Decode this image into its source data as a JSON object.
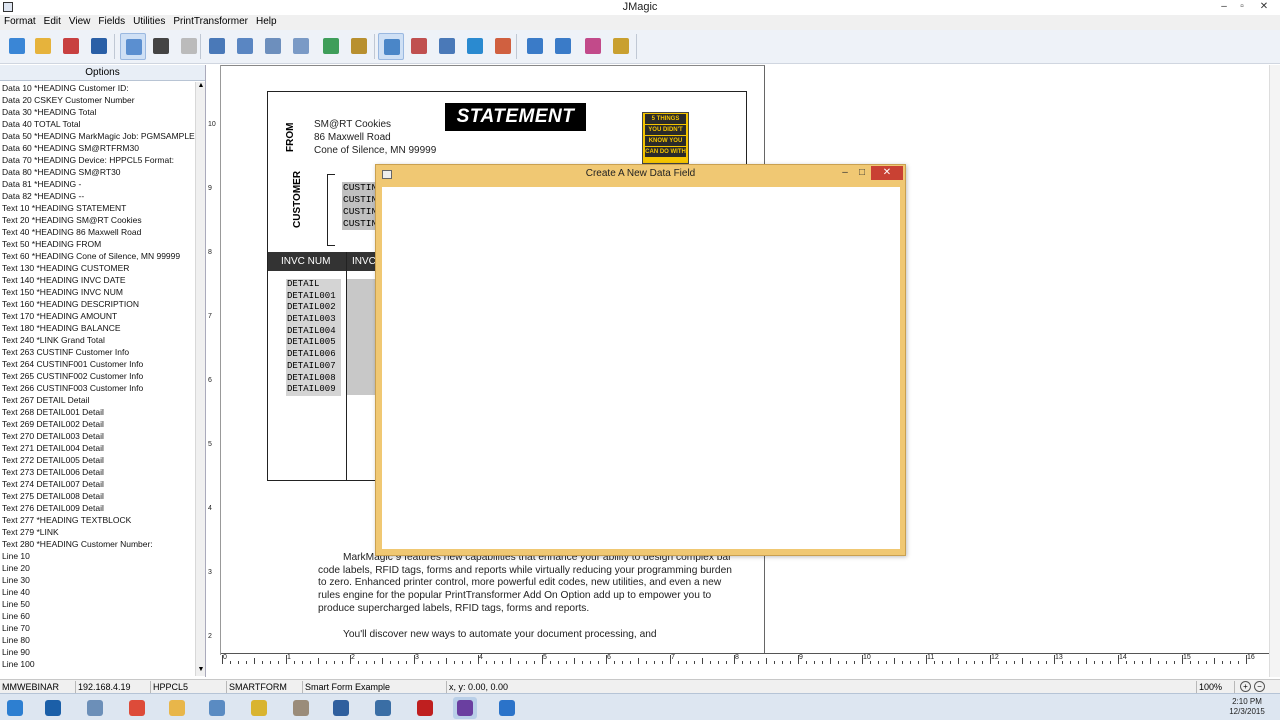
{
  "window": {
    "title": "JMagic",
    "minimize": "–",
    "maximize": "▫",
    "close": "✕"
  },
  "menu": [
    "Format",
    "Edit",
    "View",
    "Fields",
    "Utilities",
    "PrintTransformer",
    "Help"
  ],
  "toolbar": {
    "buttons": [
      {
        "name": "new-form-icon",
        "color": "#3a86d6"
      },
      {
        "name": "open-folder-icon",
        "color": "#e6b33c"
      },
      {
        "name": "save-icon",
        "color": "#c84040"
      },
      {
        "name": "save-as-icon",
        "color": "#2a5fa6"
      },
      {
        "name": "select-pointer-icon",
        "color": "#5b8fd0",
        "active": true
      },
      {
        "name": "barcode-icon",
        "color": "#444"
      },
      {
        "name": "disabled-icon",
        "color": "#bbbbbb"
      },
      {
        "name": "text-field-icon",
        "color": "#4a79b8"
      },
      {
        "name": "data-field-icon",
        "color": "#5a86c2"
      },
      {
        "name": "box-icon",
        "color": "#6d8fbd"
      },
      {
        "name": "line-icon",
        "color": "#7a9ac6"
      },
      {
        "name": "image-icon",
        "color": "#3f9e5a"
      },
      {
        "name": "edit-text-icon",
        "color": "#b89030"
      },
      {
        "name": "grid-icon",
        "color": "#4a86c8",
        "active": true
      },
      {
        "name": "field-props-icon",
        "color": "#c05050"
      },
      {
        "name": "list-icon",
        "color": "#4a79b8"
      },
      {
        "name": "table-icon",
        "color": "#2a8ad0"
      },
      {
        "name": "preview-icon",
        "color": "#d06040"
      },
      {
        "name": "zoom-in-icon",
        "color": "#3a7bc8"
      },
      {
        "name": "zoom-out-icon",
        "color": "#3a7bc8"
      },
      {
        "name": "undo-icon",
        "color": "#c24a8a"
      },
      {
        "name": "print-icon",
        "color": "#c9a030"
      }
    ]
  },
  "options": {
    "header": "Options",
    "items": [
      "Data 10 *HEADING Customer ID:",
      "Data 20 CSKEY Customer Number",
      "Data 30 *HEADING Total",
      "Data 40 TOTAL Total",
      "Data 50 *HEADING MarkMagic Job:  PGMSAMPLES/",
      "Data 60 *HEADING SM@RTFRM30",
      "Data 70 *HEADING Device: HPPCL5   Format:",
      "Data 80 *HEADING SM@RT30",
      "Data 81 *HEADING -",
      "Data 82 *HEADING --",
      "Text 10 *HEADING STATEMENT",
      "Text 20 *HEADING SM@RT Cookies",
      "Text 40 *HEADING 86 Maxwell Road",
      "Text 50 *HEADING FROM",
      "Text 60 *HEADING Cone of Silence, MN  99999",
      "Text 130 *HEADING CUSTOMER",
      "Text 140 *HEADING INVC DATE",
      "Text 150 *HEADING INVC NUM",
      "Text 160 *HEADING DESCRIPTION",
      "Text 170 *HEADING AMOUNT",
      "Text 180 *HEADING BALANCE",
      "Text 240 *LINK Grand Total",
      "Text 263 CUSTINF Customer Info",
      "Text 264 CUSTINF001 Customer Info",
      "Text 265 CUSTINF002 Customer Info",
      "Text 266 CUSTINF003 Customer Info",
      "Text 267 DETAIL Detail",
      "Text 268 DETAIL001 Detail",
      "Text 269 DETAIL002 Detail",
      "Text 270 DETAIL003 Detail",
      "Text 271 DETAIL004 Detail",
      "Text 272 DETAIL005 Detail",
      "Text 273 DETAIL006 Detail",
      "Text 274 DETAIL007 Detail",
      "Text 275 DETAIL008 Detail",
      "Text 276 DETAIL009 Detail",
      "Text 277 *HEADING TEXTBLOCK",
      "Text 279 *LINK",
      "Text 280 *HEADING Customer Number:",
      "Line 10",
      "Line 20",
      "Line 30",
      "Line 40",
      "Line 50",
      "Line 60",
      "Line 70",
      "Line 80",
      "Line 90",
      "Line 100"
    ]
  },
  "form": {
    "statement_title": "STATEMENT",
    "from_label": "FROM",
    "from_lines": [
      "SM@RT Cookies",
      "86 Maxwell Road",
      "Cone of Silence, MN  99999"
    ],
    "customer_label": "CUSTOMER",
    "custinf_lines": [
      "CUSTINF",
      "CUSTINF",
      "CUSTINF",
      "CUSTINF"
    ],
    "invc_num": "INVC NUM",
    "invc_date": "INVC DA",
    "details": [
      "DETAIL",
      "DETAIL001",
      "DETAIL002",
      "DETAIL003",
      "DETAIL004",
      "DETAIL005",
      "DETAIL006",
      "DETAIL007",
      "DETAIL008",
      "DETAIL009"
    ],
    "book_lines": [
      "5 THINGS",
      "YOU DIDN'T",
      "KNOW YOU",
      "CAN DO WITH"
    ],
    "body_paragraphs": [
      "MarkMagic 9 features new capabilities that enhance your ability to design complex bar code labels, RFID tags, forms and reports while virtually reducing your programming burden to zero. Enhanced printer control, more powerful edit codes, new utilities, and even a new rules engine for the popular PrintTransformer Add On Option add up to empower you to produce supercharged labels, RFID tags, forms and reports.",
      "You'll discover new ways to automate your document processing, and"
    ]
  },
  "rulers": {
    "vertical": [
      "10",
      "9",
      "8",
      "7",
      "6",
      "5",
      "4",
      "3",
      "2"
    ],
    "horizontal": [
      "0",
      "1",
      "2",
      "3",
      "4",
      "5",
      "6",
      "7",
      "8",
      "9",
      "10",
      "11",
      "12",
      "13",
      "14",
      "15",
      "16"
    ]
  },
  "dialog": {
    "title": "Create A New Data Field",
    "minimize": "–",
    "maximize": "□",
    "close": "✕"
  },
  "statusbar": {
    "user": "MMWEBINAR",
    "ip": "192.168.4.19",
    "device": "HPPCL5",
    "format": "SMARTFORM",
    "form_name": "Smart Form Example",
    "coords": "x, y:  0.00,  0.00",
    "zoom": "100%"
  },
  "taskbar": {
    "items": [
      {
        "name": "windows-start-icon",
        "color": "#2d7fd1"
      },
      {
        "name": "outlook-icon",
        "color": "#1b5fa8"
      },
      {
        "name": "network-icon",
        "color": "#6c8fb8"
      },
      {
        "name": "chrome-icon",
        "color": "#dd4b39"
      },
      {
        "name": "file-explorer-icon",
        "color": "#e8b64a"
      },
      {
        "name": "remote-desktop-icon",
        "color": "#5a8bc2"
      },
      {
        "name": "gear-app-icon",
        "color": "#d9b430"
      },
      {
        "name": "paint-icon",
        "color": "#9a8c7a"
      },
      {
        "name": "virtualbox-icon",
        "color": "#2f5f9e"
      },
      {
        "name": "tools-icon",
        "color": "#3a6ea5"
      },
      {
        "name": "filezilla-icon",
        "color": "#bf1f1f"
      },
      {
        "name": "magic-hat-icon",
        "color": "#6a3fa0",
        "selected": true
      },
      {
        "name": "snowflake-app-icon",
        "color": "#2b73c9"
      }
    ],
    "time": "2:10 PM",
    "date": "12/3/2015"
  }
}
